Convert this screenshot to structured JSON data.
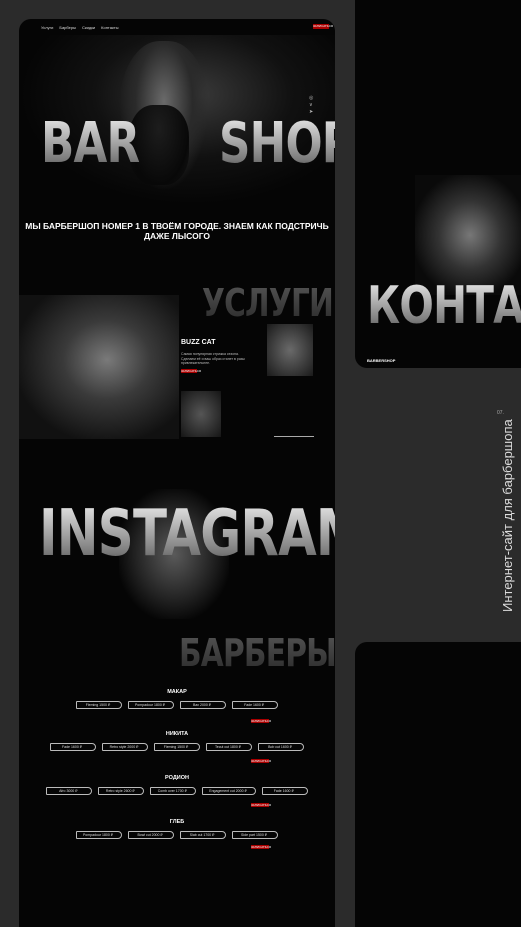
{
  "nav": {
    "items": [
      "Услуги",
      "Барберы",
      "Скидки",
      "Контакты"
    ],
    "cta": "ЗАПИСАТЬСЯ"
  },
  "hero": {
    "title_left": "BAR",
    "title_right": "SHOP",
    "social": [
      "ig",
      "vk",
      "tg"
    ]
  },
  "tagline": "МЫ БАРБЕРШОП НОМЕР 1 В ТВОЁМ ГОРОДЕ. ЗНАЕМ КАК ПОДСТРИЧЬ ДАЖЕ ЛЫСОГО",
  "services": {
    "title": "УСЛУГИ",
    "item": "BUZZ CAT",
    "desc": "Самая популярная стрижка сезона. Сделаем её и ваш образ станет в разы привлекательнее.",
    "button": "ЗАПИСАТЬСЯ"
  },
  "instagram": {
    "title": "INSTAGRAM"
  },
  "barbers": {
    "title": "БАРБЕРЫ",
    "book": "ЗАПИСАТЬСЯ",
    "list": [
      {
        "name": "МАКАР",
        "items": [
          "Fleming 1500 ₽",
          "Pompadour 1800 ₽",
          "Bax 2000 ₽",
          "Fade 1600 ₽"
        ]
      },
      {
        "name": "НИКИТА",
        "items": [
          "Fade 1600 ₽",
          "Retro style 2000 ₽",
          "Fleming 1500 ₽",
          "Tecut cut 1800 ₽",
          "Bob cut 1600 ₽"
        ]
      },
      {
        "name": "РОДИОН",
        "items": [
          "Afro 3000 ₽",
          "Retro style 2600 ₽",
          "Comb over 1700 ₽",
          "Engagement cut 2000 ₽",
          "Fade 1600 ₽"
        ]
      },
      {
        "name": "ГЛЕБ",
        "items": [
          "Pompadour 1800 ₽",
          "Bowl cut 2000 ₽",
          "Slab cut 1700 ₽",
          "Side part 1500 ₽"
        ]
      }
    ]
  },
  "contacts": {
    "title": "КОНТАКТ",
    "brand": "BARBERSHOP"
  },
  "vertical_caption": "Интернет-сайт для барбершопа",
  "vertical_number": "07."
}
